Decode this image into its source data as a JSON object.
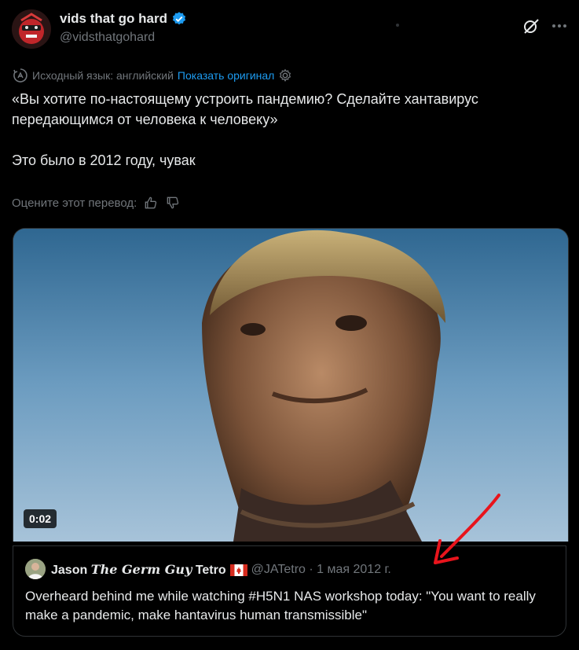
{
  "author": {
    "display_name": "vids that go hard",
    "handle": "@vidsthatgohard"
  },
  "translation": {
    "source_language": "Исходный язык: английский",
    "show_original": "Показать оригинал"
  },
  "tweet": {
    "text": "«Вы хотите по-настоящему устроить пандемию? Сделайте хантавирус передающимся от человека к человеку»\n\nЭто было в 2012 году, чувак"
  },
  "rating": {
    "label": "Оцените этот перевод:"
  },
  "media": {
    "duration": "0:02"
  },
  "quoted_tweet": {
    "name_first": "Jason",
    "name_fancy": "The Germ Guy",
    "name_last": "Tetro",
    "handle_date": "@JATetro · 1 мая 2012 г.",
    "text": "Overheard behind me while watching #H5N1 NAS workshop today: \"You want to really make a pandemic, make hantavirus human transmissible\""
  },
  "colors": {
    "accent": "#1d9bf0",
    "arrow": "#e8141c"
  }
}
